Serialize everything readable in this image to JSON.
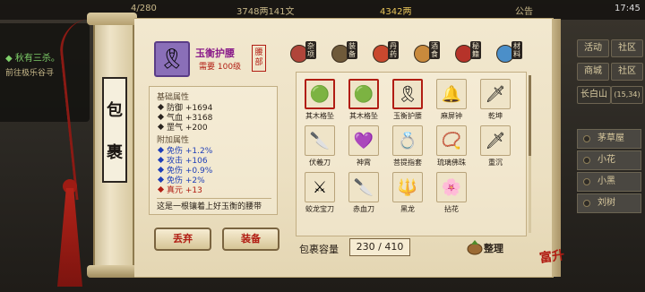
{
  "top_bar": {
    "count": "4/280",
    "money": "3748两141文",
    "gold": "4342两",
    "notice": "公告",
    "time": "17:45"
  },
  "quest": {
    "title": "◆ 秋有三杀。",
    "desc": "前往极乐谷寻"
  },
  "right_menu": {
    "buttons": [
      "活动",
      "社区",
      "商城",
      "社区",
      "长白山"
    ],
    "coords": "(15,34)",
    "list": [
      "茅草屋",
      "小花",
      "小黑",
      "刘树"
    ]
  },
  "panel": {
    "title_chars": [
      "包",
      "裹"
    ]
  },
  "item": {
    "name": "玉衡护腰",
    "level_req": "需要 100级",
    "slot": "腰部",
    "base_title": "基础属性",
    "base_attrs": [
      {
        "label": "防御",
        "value": "+1694"
      },
      {
        "label": "气血",
        "value": "+3168"
      },
      {
        "label": "罡气",
        "value": "+200"
      }
    ],
    "extra_title": "附加属性",
    "extra_attrs": [
      {
        "label": "免伤",
        "value": "+1.2%",
        "color": "blue"
      },
      {
        "label": "攻击",
        "value": "+106",
        "color": "blue"
      },
      {
        "label": "免伤",
        "value": "+0.9%",
        "color": "blue"
      },
      {
        "label": "免伤",
        "value": "+2%",
        "color": "blue"
      },
      {
        "label": "真元",
        "value": "+13",
        "color": "red"
      }
    ],
    "desc": "这是一根镶着上好玉衡的腰带"
  },
  "buttons": {
    "drop": "丢弃",
    "equip": "装备"
  },
  "tabs": [
    {
      "label": "杂项",
      "icon": "misc-icon",
      "color": "#b0453a"
    },
    {
      "label": "装备",
      "icon": "equipment-icon",
      "color": "#6f5a3a"
    },
    {
      "label": "丹药",
      "icon": "pill-icon",
      "color": "#c9482e"
    },
    {
      "label": "酒食",
      "icon": "food-icon",
      "color": "#c98a3c"
    },
    {
      "label": "秘籍",
      "icon": "book-icon",
      "color": "#b6332a"
    },
    {
      "label": "材料",
      "icon": "material-icon",
      "color": "#4b8fc9"
    }
  ],
  "inventory": [
    {
      "name": "其木格坠",
      "icon": "jade-pendant-icon",
      "glyph": "🟢",
      "selected": true
    },
    {
      "name": "其木格坠",
      "icon": "jade-pendant-icon",
      "glyph": "🟢",
      "selected": true
    },
    {
      "name": "玉衡护腰",
      "icon": "belt-icon",
      "glyph": "🎗",
      "selected": true
    },
    {
      "name": "麻屏钟",
      "icon": "bell-icon",
      "glyph": "🔔",
      "selected": false
    },
    {
      "name": "乾坤",
      "icon": "sword-icon",
      "glyph": "🗡",
      "selected": false
    },
    {
      "name": "伏羲刀",
      "icon": "blade-icon",
      "glyph": "🔪",
      "selected": false
    },
    {
      "name": "神霄",
      "icon": "claw-icon",
      "glyph": "💜",
      "selected": false
    },
    {
      "name": "菩提指套",
      "icon": "finger-guard-icon",
      "glyph": "💍",
      "selected": false
    },
    {
      "name": "琉璃佛珠",
      "icon": "beads-icon",
      "glyph": "📿",
      "selected": false
    },
    {
      "name": "重沉",
      "icon": "dagger-icon",
      "glyph": "🗡",
      "selected": false
    },
    {
      "name": "蛟龙宝刀",
      "icon": "dragon-blade-icon",
      "glyph": "⚔",
      "selected": false
    },
    {
      "name": "赤血刀",
      "icon": "red-blade-icon",
      "glyph": "🔪",
      "selected": false
    },
    {
      "name": "黑龙",
      "icon": "spear-icon",
      "glyph": "🔱",
      "selected": false
    },
    {
      "name": "拈花",
      "icon": "flower-icon",
      "glyph": "🌸",
      "selected": false
    }
  ],
  "capacity": {
    "label": "包裹容量",
    "value": "230 / 410"
  },
  "sort": {
    "label": "整理"
  },
  "seal": "富升"
}
